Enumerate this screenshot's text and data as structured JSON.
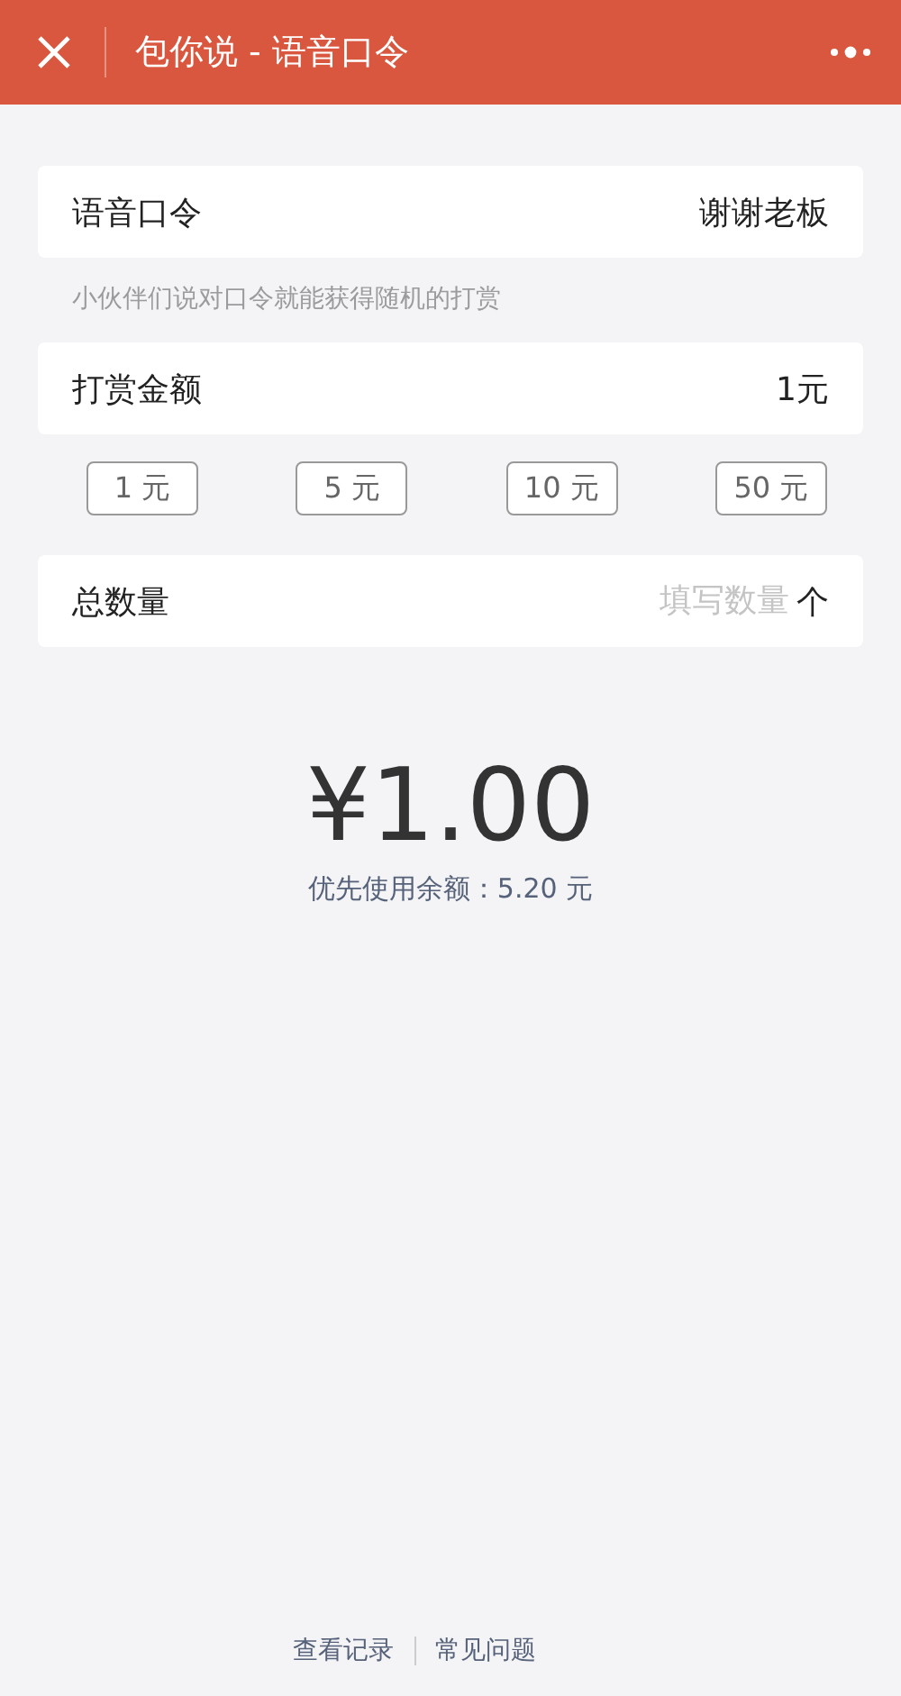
{
  "header": {
    "title": "包你说 - 语音口令"
  },
  "password": {
    "label": "语音口令",
    "value": "谢谢老板"
  },
  "hint": "小伙伴们说对口令就能获得随机的打赏",
  "amount": {
    "label": "打赏金额",
    "value": "1元"
  },
  "amount_options": [
    "1 元",
    "5 元",
    "10 元",
    "50 元"
  ],
  "quantity": {
    "label": "总数量",
    "placeholder": "填写数量",
    "unit": "个"
  },
  "total": "¥1.00",
  "balance": "优先使用余额：5.20 元",
  "footer_links": [
    "查看记录",
    "常见问题"
  ]
}
